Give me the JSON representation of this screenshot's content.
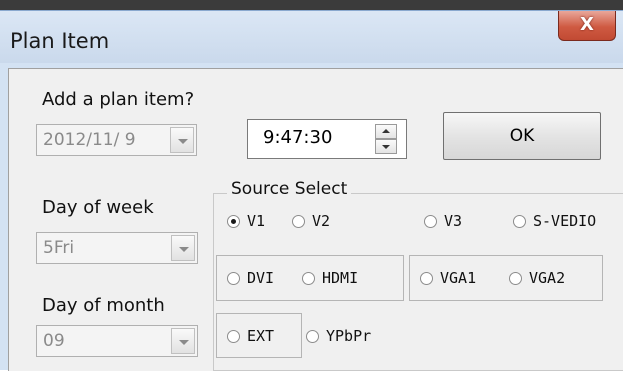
{
  "window": {
    "title": "Plan Item",
    "close_glyph": "X"
  },
  "form": {
    "add_label": "Add a plan item?",
    "date_value": "2012/11/ 9",
    "time_value": "9:47:30",
    "ok_label": "OK",
    "day_of_week_label": "Day of week",
    "day_of_week_value": "5Fri",
    "day_of_month_label": "Day of month",
    "day_of_month_value": "09"
  },
  "source": {
    "title": "Source Select",
    "options": [
      "V1",
      "V2",
      "V3",
      "S-VEDIO",
      "DVI",
      "HDMI",
      "VGA1",
      "VGA2",
      "EXT",
      "YPbPr"
    ],
    "selected": "V1"
  },
  "icons": {
    "close": "close-icon",
    "dropdown": "chevron-down-icon",
    "spin_up": "arrow-up-icon",
    "spin_down": "arrow-down-icon"
  }
}
